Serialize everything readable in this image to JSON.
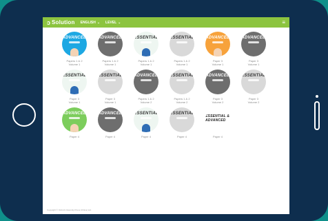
{
  "topbar": {
    "logo_small": "ENGLISH",
    "logo": "Solution",
    "nav": [
      {
        "label": "ENGLISH",
        "chevron": "⌄"
      },
      {
        "label": "LEVEL",
        "chevron": "⌄"
      }
    ],
    "menu_icon": "≡"
  },
  "books": [
    {
      "title": "ADVANCED",
      "style": "blue",
      "caption1": "Papers 1 & 2",
      "caption2": "Volume 1"
    },
    {
      "title": "ADVANCED",
      "style": "dgray",
      "caption1": "Papers 1 & 2",
      "caption2": "Volume 1"
    },
    {
      "title": "ESSENTIAL",
      "style": "white",
      "caption1": "Papers 1 & 2",
      "caption2": "Volume 1"
    },
    {
      "title": "ESSENTIAL",
      "style": "lgray",
      "caption1": "Papers 1 & 2",
      "caption2": "Volume 1"
    },
    {
      "title": "ADVANCED",
      "style": "orange",
      "caption1": "Paper 3",
      "caption2": "Volume 1"
    },
    {
      "title": "ADVANCED",
      "style": "dgray",
      "caption1": "Paper 3",
      "caption2": "Volume 1"
    },
    {
      "title": "ESSENTIAL",
      "style": "white",
      "caption1": "Paper 3",
      "caption2": "Volume 1"
    },
    {
      "title": "ESSENTIAL",
      "style": "lgray",
      "caption1": "Paper 3",
      "caption2": "Volume 1"
    },
    {
      "title": "ADVANCED",
      "style": "dgray",
      "caption1": "Papers 1 & 2",
      "caption2": "Volume 2"
    },
    {
      "title": "ESSENTIAL",
      "style": "lgray",
      "caption1": "Papers 1 & 2",
      "caption2": "Volume 2"
    },
    {
      "title": "ADVANCED",
      "style": "dgray",
      "caption1": "Paper 3",
      "caption2": "Volume 2"
    },
    {
      "title": "ESSENTIAL",
      "style": "lgray",
      "caption1": "Paper 3",
      "caption2": "Volume 2"
    },
    {
      "title": "ADVANCED",
      "style": "green",
      "caption1": "Paper 4",
      "caption2": ""
    },
    {
      "title": "ADVANCED",
      "style": "dgray",
      "caption1": "Paper 4",
      "caption2": ""
    },
    {
      "title": "ESSENTIAL",
      "style": "white",
      "caption1": "Paper 4",
      "caption2": ""
    },
    {
      "title": "ESSENTIAL",
      "style": "lgray",
      "caption1": "Paper 4",
      "caption2": ""
    },
    {
      "title": "ESSENTIAL & ADVANCED",
      "style": "combo",
      "caption1": "Paper 4",
      "caption2": ""
    }
  ],
  "footer": "Copyright © Oxford University Press (China) Ltd."
}
